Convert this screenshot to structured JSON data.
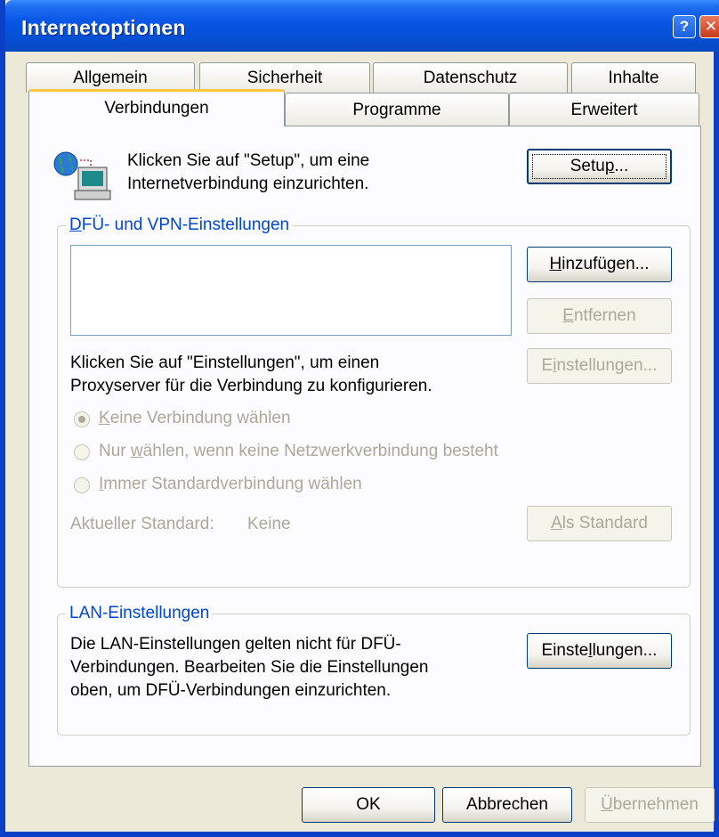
{
  "window": {
    "title": "Internetoptionen",
    "help_glyph": "?",
    "close_glyph": "✕"
  },
  "tabs": {
    "row1": [
      "Allgemein",
      "Sicherheit",
      "Datenschutz",
      "Inhalte"
    ],
    "row2": [
      "Verbindungen",
      "Programme",
      "Erweitert"
    ],
    "active": "Verbindungen"
  },
  "setup": {
    "text_line1": "Klicken Sie auf \"Setup\", um eine",
    "text_line2": "Internetverbindung einzurichten.",
    "button_pre": "Setu",
    "button_acc": "p",
    "button_post": "...",
    "icon": "globe-computer-icon"
  },
  "dialup": {
    "legend_acc": "D",
    "legend_rest": "FÜ- und VPN-Einstellungen",
    "add_acc": "H",
    "add_post": "inzufügen...",
    "remove_acc": "E",
    "remove_post": "ntfernen",
    "settings_pre": "E",
    "settings_acc": "i",
    "settings_post": "nstellungen...",
    "proxy_line1": "Klicken Sie auf \"Einstellungen\", um einen",
    "proxy_line2": "Proxyserver für die Verbindung zu konfigurieren.",
    "radio1_acc": "K",
    "radio1_post": "eine Verbindung wählen",
    "radio2_pre": "Nur ",
    "radio2_acc": "w",
    "radio2_post": "ählen, wenn keine Netzwerkverbindung besteht",
    "radio3_acc": "I",
    "radio3_post": "mmer Standardverbindung wählen",
    "current_label": "Aktueller Standard:",
    "current_value": "Keine",
    "setdefault_acc": "A",
    "setdefault_post": "ls Standard"
  },
  "lan": {
    "legend": "LAN-Einstellungen",
    "line1": "Die LAN-Einstellungen gelten nicht für DFÜ-",
    "line2": "Verbindungen. Bearbeiten Sie die Einstellungen",
    "line3": "oben, um DFÜ-Verbindungen einzurichten.",
    "settings_pre": "Einste",
    "settings_acc": "l",
    "settings_post": "lungen..."
  },
  "footer": {
    "ok": "OK",
    "cancel": "Abbrechen",
    "apply_acc": "Ü",
    "apply_post": "bernehmen"
  },
  "colors": {
    "accent": "#0046D5",
    "titlebar": "#0550D6",
    "tab_highlight": "#FFC83C"
  }
}
